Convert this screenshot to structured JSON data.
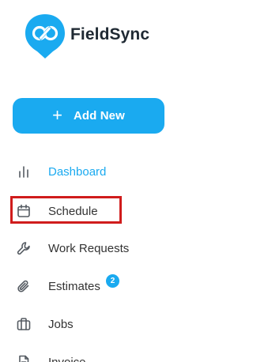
{
  "app": {
    "name": "FieldSync",
    "logo_icon": "fieldsync-logo-icon"
  },
  "colors": {
    "brand": "#1aaaf0",
    "highlight": "#d01c1c",
    "text": "#333333"
  },
  "add_new": {
    "icon": "plus-icon",
    "plus_glyph": "+",
    "label": "Add New"
  },
  "nav": {
    "items": [
      {
        "label": "Dashboard",
        "icon": "bar-chart-icon",
        "active": true
      },
      {
        "label": "Schedule",
        "icon": "calendar-icon",
        "active": false,
        "highlighted": true
      },
      {
        "label": "Work Requests",
        "icon": "wrench-icon",
        "active": false
      },
      {
        "label": "Estimates",
        "icon": "paperclip-icon",
        "active": false,
        "badge": "2"
      },
      {
        "label": "Jobs",
        "icon": "briefcase-icon",
        "active": false
      },
      {
        "label": "Invoice",
        "icon": "document-icon",
        "active": false
      }
    ]
  }
}
